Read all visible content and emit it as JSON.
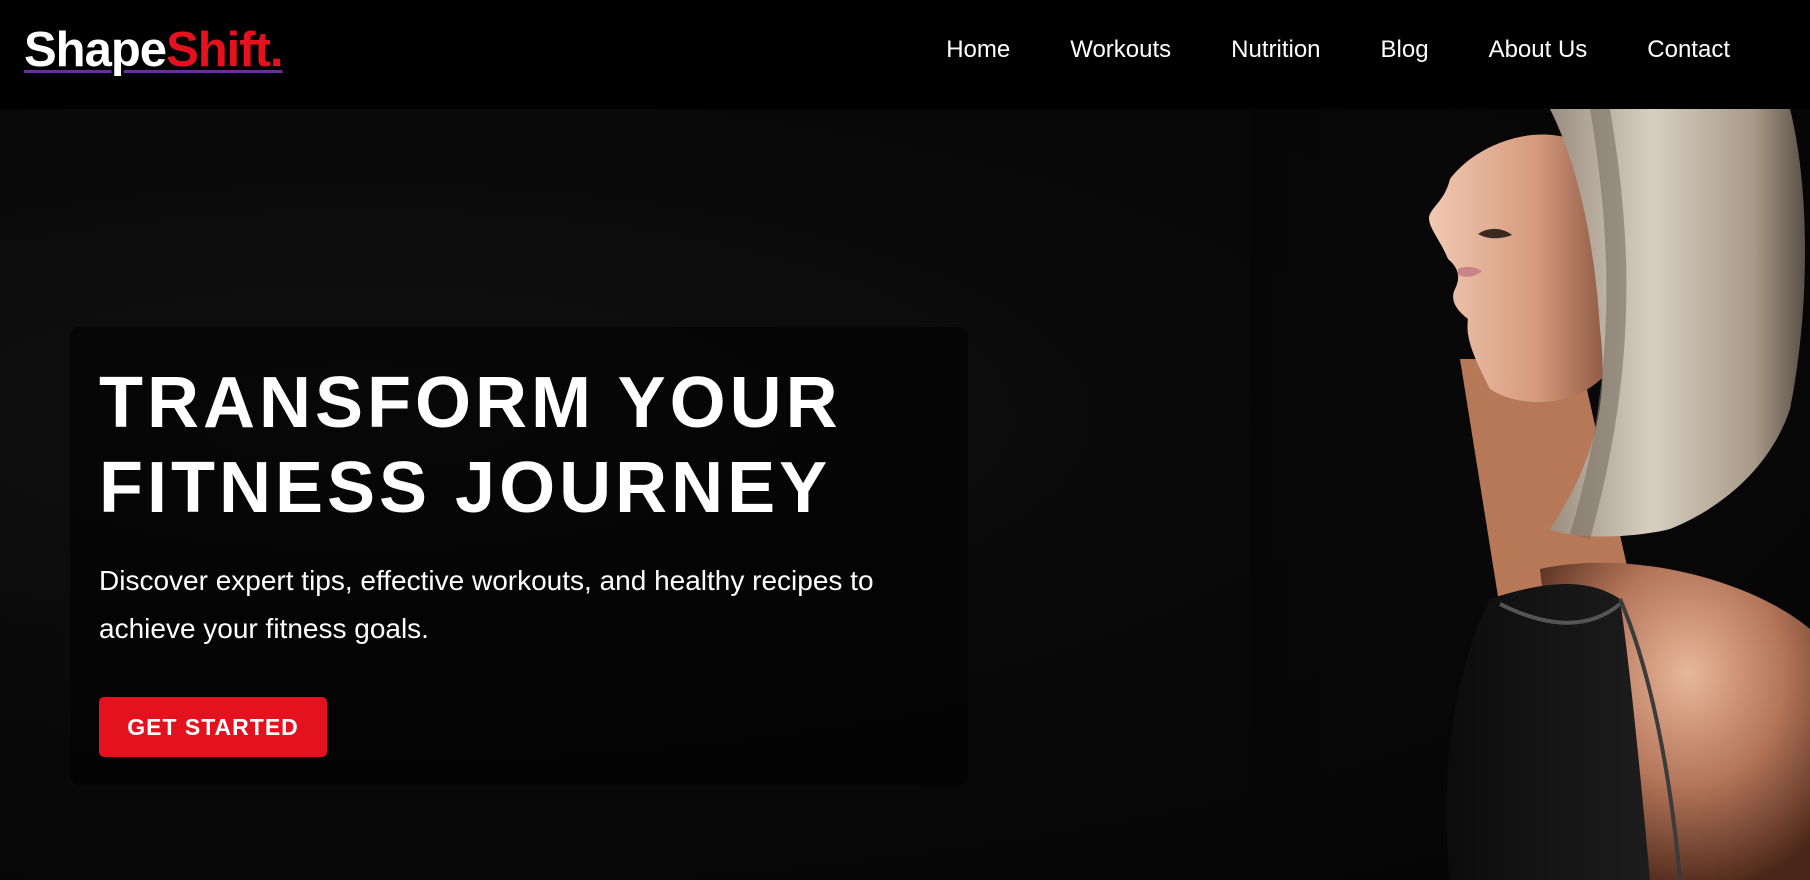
{
  "brand": {
    "name_part1": "Shape",
    "name_part2": "Shift.",
    "accent_color": "#e3121e",
    "underline_color": "#6a2ea0"
  },
  "nav": {
    "items": [
      {
        "label": "Home"
      },
      {
        "label": "Workouts"
      },
      {
        "label": "Nutrition"
      },
      {
        "label": "Blog"
      },
      {
        "label": "About Us"
      },
      {
        "label": "Contact"
      }
    ]
  },
  "hero": {
    "title_line1": "TRANSFORM YOUR",
    "title_line2": "FITNESS JOURNEY",
    "subtitle": "Discover expert tips, effective workouts, and healthy recipes to achieve your fitness goals.",
    "cta_label": "GET STARTED",
    "cta_color": "#e3121e",
    "image_icon": "athlete-profile-photo"
  }
}
